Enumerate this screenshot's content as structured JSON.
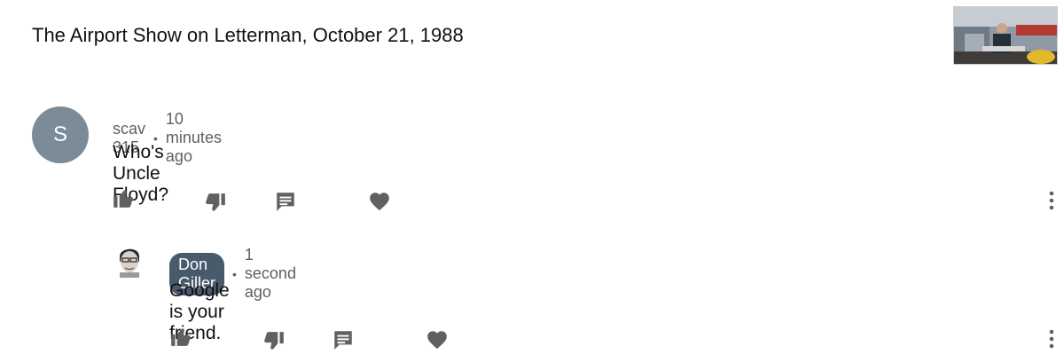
{
  "video": {
    "title": "The Airport Show on Letterman, October 21, 1988"
  },
  "comments": [
    {
      "avatar_letter": "S",
      "avatar_color": "#7b8b98",
      "author": "scav 315",
      "separator": "•",
      "time": "10 minutes ago",
      "text": "Who's Uncle Floyd?"
    },
    {
      "author": "Don Giller",
      "author_chip_color": "#4a5a6d",
      "separator": "•",
      "time": "1 second ago",
      "text": "Google is your friend."
    }
  ],
  "actions": {
    "icons": [
      "thumbs-up-icon",
      "thumbs-down-icon",
      "reply-icon",
      "heart-icon",
      "more-vert-icon"
    ],
    "icon_color": "#606060"
  }
}
